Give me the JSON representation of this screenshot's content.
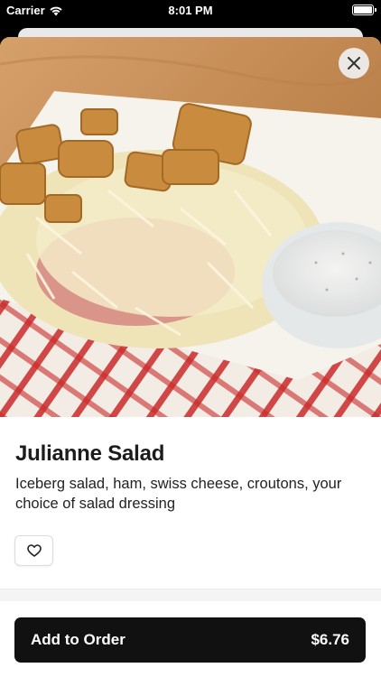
{
  "status_bar": {
    "carrier": "Carrier",
    "time": "8:01 PM"
  },
  "item": {
    "name": "Julianne Salad",
    "description": "Iceberg salad, ham, swiss cheese, croutons, your choice of salad dressing",
    "image_icon": "salad-photo"
  },
  "actions": {
    "close_icon": "close-icon",
    "favorite_icon": "heart-icon",
    "add_label": "Add to Order",
    "price": "$6.76"
  }
}
